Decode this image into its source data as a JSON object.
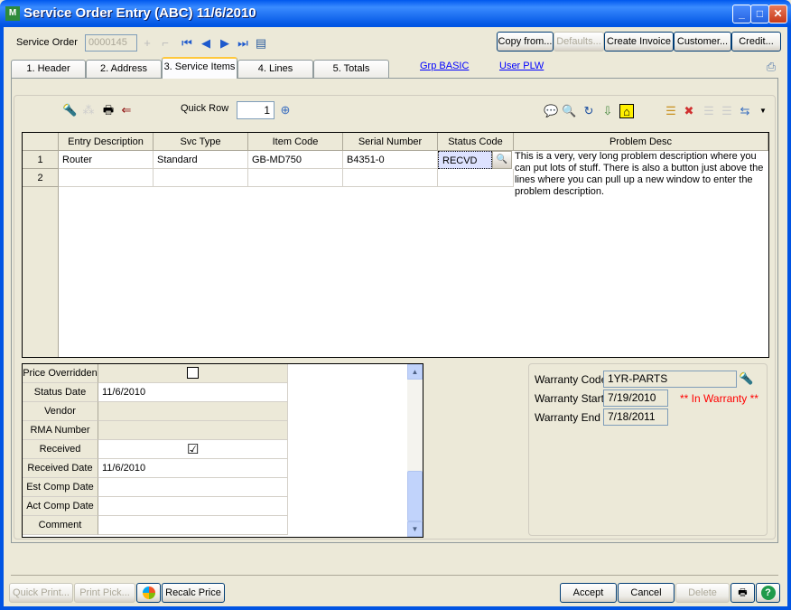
{
  "window": {
    "title": "Service Order Entry (ABC) 11/6/2010",
    "minimize": "_",
    "maximize": "□",
    "close": "✕"
  },
  "header": {
    "service_order_label": "Service Order",
    "service_order_value": "0000145",
    "buttons": {
      "copy_from": "Copy from...",
      "defaults": "Defaults...",
      "create_invoice": "Create Invoice",
      "customer": "Customer...",
      "credit": "Credit..."
    }
  },
  "tabs": [
    {
      "label": "1. Header"
    },
    {
      "label": "2. Address"
    },
    {
      "label": "3. Service Items",
      "selected": true
    },
    {
      "label": "4. Lines"
    },
    {
      "label": "5. Totals"
    }
  ],
  "links": {
    "grp": "Grp BASIC",
    "user": "User PLW"
  },
  "toolbar": {
    "quick_row_label": "Quick Row",
    "quick_row_value": "1"
  },
  "grid": {
    "columns": [
      "Entry Description",
      "Svc Type",
      "Item Code",
      "Serial Number",
      "Status Code",
      "Problem Desc"
    ],
    "rows": [
      {
        "num": "1",
        "entry_description": "Router",
        "svc_type": "Standard",
        "item_code": "GB-MD750",
        "serial_number": "B4351-0",
        "status_code": "RECVD",
        "problem_desc": "This is a very, very long problem description where you can put lots of stuff.   There is also a button just above the lines where you can pull up a new window to enter the problem description."
      },
      {
        "num": "2",
        "entry_description": "",
        "svc_type": "",
        "item_code": "",
        "serial_number": "",
        "status_code": "",
        "problem_desc": ""
      }
    ]
  },
  "details": {
    "price_overridden": {
      "label": "Price Overridden",
      "checked": false
    },
    "status_date": {
      "label": "Status Date",
      "value": "11/6/2010"
    },
    "vendor": {
      "label": "Vendor",
      "value": ""
    },
    "rma_number": {
      "label": "RMA Number",
      "value": ""
    },
    "received": {
      "label": "Received",
      "checked": true,
      "mark": "☑"
    },
    "received_date": {
      "label": "Received Date",
      "value": "11/6/2010"
    },
    "est_comp_date": {
      "label": "Est Comp Date",
      "value": ""
    },
    "act_comp_date": {
      "label": "Act Comp Date",
      "value": ""
    },
    "comment": {
      "label": "Comment",
      "value": ""
    }
  },
  "warranty": {
    "code_label": "Warranty Code",
    "code": "1YR-PARTS",
    "start_label": "Warranty Start",
    "start": "7/19/2010",
    "end_label": "Warranty End",
    "end": "7/18/2011",
    "status": "** In Warranty **",
    "status_color": "#FF0000"
  },
  "footer": {
    "quick_print": "Quick Print...",
    "print_pick": "Print Pick...",
    "recalc_price": "Recalc Price",
    "accept": "Accept",
    "cancel": "Cancel",
    "delete": "Delete"
  }
}
